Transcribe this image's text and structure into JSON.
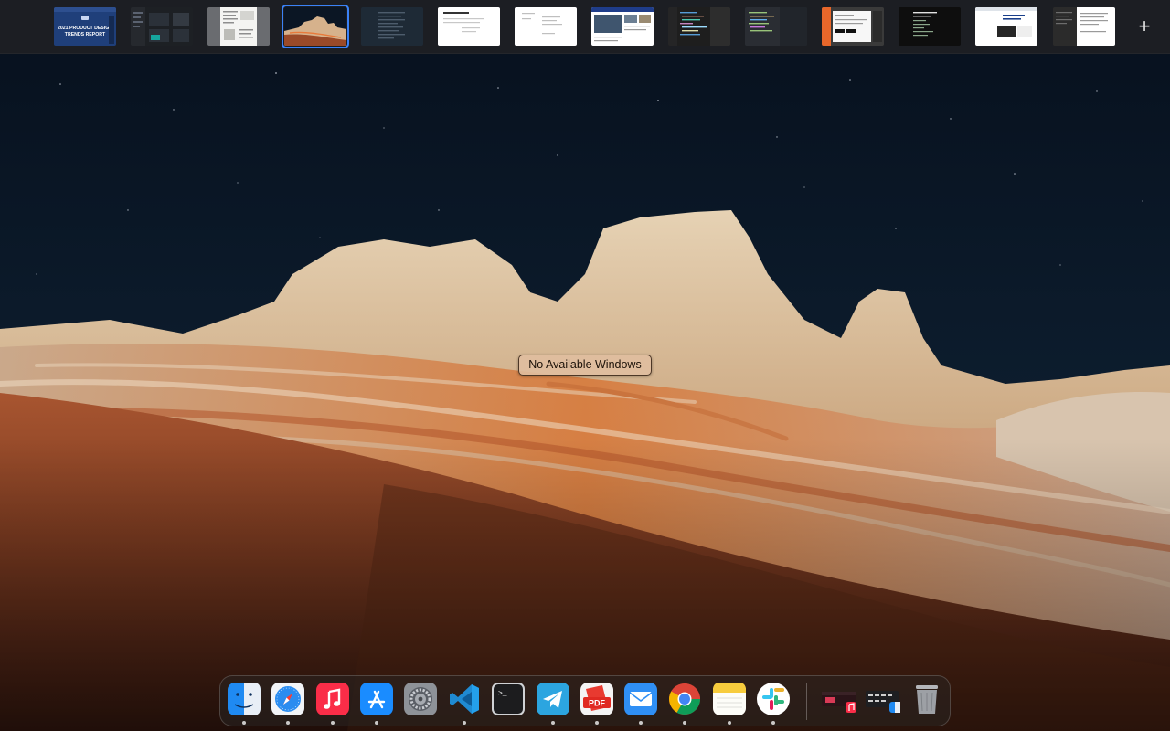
{
  "desktop": {
    "no_windows_label": "No Available Windows"
  },
  "spaces": {
    "selected_index": 3,
    "thumbnails": [
      {
        "icon": "report-preview",
        "title": "2021 PRODUCT DESIGN TRENDS REPORT"
      },
      {
        "icon": "dark-app-preview"
      },
      {
        "icon": "document-preview"
      },
      {
        "icon": "desktop-wallpaper-preview"
      },
      {
        "icon": "dark-text-preview"
      },
      {
        "icon": "white-document-preview"
      },
      {
        "icon": "white-document-preview"
      },
      {
        "icon": "news-site-preview"
      },
      {
        "icon": "code-editor-preview"
      },
      {
        "icon": "code-editor-preview"
      },
      {
        "icon": "browser-preview"
      },
      {
        "icon": "terminal-preview"
      },
      {
        "icon": "white-document-preview"
      },
      {
        "icon": "split-document-preview"
      }
    ],
    "add_button": "+"
  },
  "dock": {
    "items": [
      {
        "name": "finder",
        "icon": "finder-icon",
        "running": true
      },
      {
        "name": "safari",
        "icon": "safari-icon",
        "running": true
      },
      {
        "name": "music",
        "icon": "music-icon",
        "running": true
      },
      {
        "name": "app-store",
        "icon": "app-store-icon",
        "running": true
      },
      {
        "name": "system-preferences",
        "icon": "gear-icon",
        "running": false
      },
      {
        "name": "vscode",
        "icon": "vscode-icon",
        "running": true
      },
      {
        "name": "terminal",
        "icon": "terminal-icon",
        "running": false
      },
      {
        "name": "telegram",
        "icon": "telegram-icon",
        "running": true
      },
      {
        "name": "pdf-expert",
        "icon": "pdf-icon",
        "running": true,
        "label": "PDF"
      },
      {
        "name": "mail",
        "icon": "mail-icon",
        "running": true
      },
      {
        "name": "chrome",
        "icon": "chrome-icon",
        "running": true
      },
      {
        "name": "notes",
        "icon": "notes-icon",
        "running": true
      },
      {
        "name": "slack",
        "icon": "slack-icon",
        "running": true
      },
      {
        "name": "minimized-music",
        "icon": "minimized-window-icon",
        "running": false
      },
      {
        "name": "minimized-window",
        "icon": "minimized-window-icon",
        "running": false
      },
      {
        "name": "trash",
        "icon": "trash-icon",
        "running": false
      }
    ],
    "terminal_prompt": ">_"
  },
  "colors": {
    "selection_outline": "#3a82f7",
    "label_bg": "#e0bea0"
  }
}
